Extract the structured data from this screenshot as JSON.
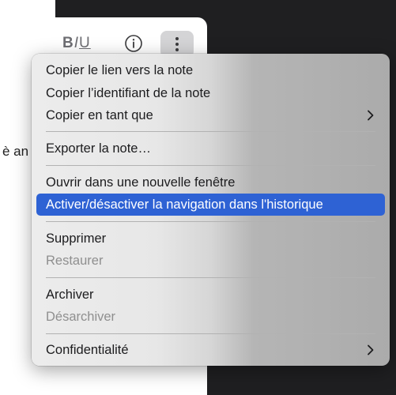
{
  "note": {
    "body_fragment": "è an"
  },
  "toolbar": {
    "format_bold": "B",
    "format_italic": "I",
    "format_underline": "U"
  },
  "menu": {
    "items": [
      {
        "label": "Copier le lien vers la note",
        "enabled": true
      },
      {
        "label": "Copier l’identifiant de la note",
        "enabled": true
      },
      {
        "label": "Copier en tant que",
        "enabled": true,
        "submenu": true
      },
      {
        "label": "Exporter la note…",
        "enabled": true
      },
      {
        "label": "Ouvrir dans une nouvelle fenêtre",
        "enabled": true
      },
      {
        "label": "Activer/désactiver la navigation dans l'historique",
        "enabled": true,
        "highlighted": true
      },
      {
        "label": "Supprimer",
        "enabled": true
      },
      {
        "label": "Restaurer",
        "enabled": false
      },
      {
        "label": "Archiver",
        "enabled": true
      },
      {
        "label": "Désarchiver",
        "enabled": false
      },
      {
        "label": "Confidentialité",
        "enabled": true,
        "submenu": true
      }
    ]
  },
  "colors": {
    "highlight": "#2e62d4",
    "disabled_text": "#8f8f8f",
    "dark_background": "#1f1f21"
  },
  "icons": [
    "info-icon",
    "more-vertical-icon",
    "chevron-right-icon"
  ]
}
